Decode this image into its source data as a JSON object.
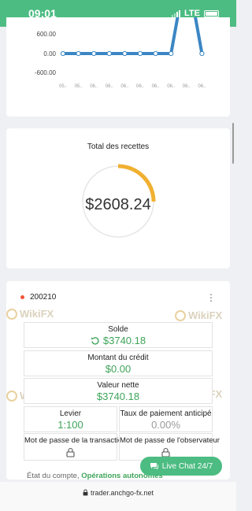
{
  "status_bar": {
    "time": "09:01",
    "network": "LTE"
  },
  "chart_data": {
    "type": "line",
    "x": [
      "05..",
      "05..",
      "06..",
      "06..",
      "06..",
      "06..",
      "06..",
      "06..",
      "06..",
      "06.."
    ],
    "values": [
      0,
      0,
      0,
      0,
      0,
      0,
      0,
      0,
      2608.24,
      0
    ],
    "yticks": [
      "600.00",
      "0.00",
      "-600.00"
    ],
    "ylim": [
      -600,
      600
    ],
    "color": "#3b86c4"
  },
  "revenue": {
    "title": "Total des recettes",
    "value": "$2608.24",
    "gauge_fraction": 0.25,
    "gauge_color": "#f0b030"
  },
  "account": {
    "id": "200210",
    "solde_label": "Solde",
    "solde_value": "$3740.18",
    "credit_label": "Montant du crédit",
    "credit_value": "$0.00",
    "nette_label": "Valeur nette",
    "nette_value": "$3740.18",
    "levier_label": "Levier",
    "levier_value": "1:100",
    "taux_label": "Taux de paiement anticipé",
    "taux_value": "0.00%",
    "pwd_transaction_label": "Mot de passe de la transaction",
    "pwd_observer_label": "Mot de passe de l'observateur",
    "status_label": "État du compte,",
    "status_value": "Opérations autonomes"
  },
  "live_chat": {
    "label": "Live Chat 24/7"
  },
  "browser": {
    "url": "trader.anchgo-fx.net"
  },
  "watermark": "WikiFX",
  "colors": {
    "brand": "#4cbc82",
    "positive": "#3fa45a"
  }
}
